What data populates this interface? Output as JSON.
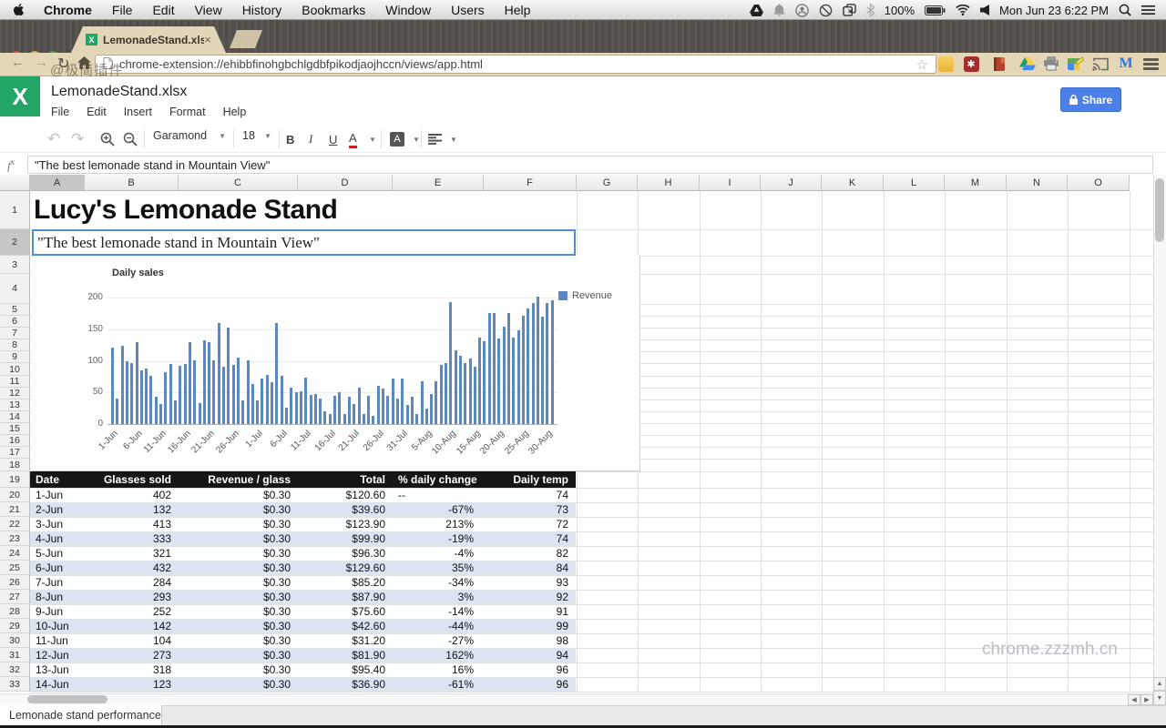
{
  "menu_bar": {
    "items": [
      "Chrome",
      "File",
      "Edit",
      "View",
      "History",
      "Bookmarks",
      "Window",
      "Users",
      "Help"
    ],
    "battery": "100%",
    "clock": "Mon Jun 23  6:22 PM"
  },
  "browser": {
    "tab_title": "LemonadeStand.xlsx",
    "url": "chrome-extension://ehibbfinohgbchlgdbfpikodjaojhccn/views/app.html"
  },
  "watermarks": {
    "address_bar": "@极简插件",
    "page": "chrome.zzzmh.cn"
  },
  "app": {
    "doc_title": "LemonadeStand.xlsx",
    "menus": [
      "File",
      "Edit",
      "Insert",
      "Format",
      "Help"
    ],
    "share_label": "Share",
    "toolbar": {
      "font_name": "Garamond",
      "font_size": "18"
    }
  },
  "formula_bar": {
    "label": "fx",
    "value": "\"The best lemonade stand in Mountain View\""
  },
  "sheet": {
    "column_letters": [
      "A",
      "B",
      "C",
      "D",
      "E",
      "F",
      "G",
      "H",
      "I",
      "J",
      "K",
      "L",
      "M",
      "N",
      "O"
    ],
    "selected_column": "A",
    "selected_row": 2,
    "cells": {
      "a1": "Lucy's Lemonade Stand",
      "a2": "\"The best lemonade stand in Mountain View\""
    },
    "sheet_tab": "Lemonade stand performance"
  },
  "chart_data": {
    "type": "bar",
    "title": "Daily sales",
    "legend": [
      "Revenue"
    ],
    "legend_position": "right",
    "color": "#5b87c3",
    "ylim": [
      0,
      200
    ],
    "yticks": [
      0,
      50,
      100,
      150,
      200
    ],
    "tick_every": 5,
    "x_tick_labels": [
      "1-Jun",
      "6-Jun",
      "11-Jun",
      "16-Jun",
      "21-Jun",
      "26-Jun",
      "1-Jul",
      "6-Jul",
      "11-Jul",
      "16-Jul",
      "21-Jul",
      "26-Jul",
      "31-Jul",
      "5-Aug",
      "10-Aug",
      "15-Aug",
      "20-Aug",
      "25-Aug",
      "30-Aug"
    ],
    "values": [
      120.6,
      39.6,
      123.9,
      99.9,
      96.3,
      129.6,
      85.2,
      87.9,
      75.6,
      42.6,
      31.2,
      81.9,
      95.4,
      36.9,
      92,
      95,
      130,
      100,
      33,
      132,
      129,
      101,
      159,
      91,
      152,
      94,
      105,
      37,
      101,
      63,
      38,
      72,
      78,
      66,
      159,
      76,
      26,
      57,
      50,
      52,
      74,
      46,
      47,
      41,
      20,
      16,
      45,
      51,
      16,
      43,
      31,
      58,
      16,
      45,
      13,
      60,
      56,
      44,
      72,
      41,
      72,
      30,
      43,
      16,
      68,
      24,
      47,
      67,
      94,
      96,
      193,
      116,
      108,
      97,
      103,
      90,
      136,
      131,
      175,
      175,
      135,
      154,
      176,
      137,
      148,
      171,
      183,
      192,
      201,
      170,
      192,
      195
    ]
  },
  "table": {
    "headers": [
      "Date",
      "Glasses sold",
      "Revenue / glass",
      "Total",
      "% daily change",
      "Daily temp"
    ],
    "rows": [
      [
        "1-Jun",
        "402",
        "$0.30",
        "$120.60",
        "--",
        "74"
      ],
      [
        "2-Jun",
        "132",
        "$0.30",
        "$39.60",
        "-67%",
        "73"
      ],
      [
        "3-Jun",
        "413",
        "$0.30",
        "$123.90",
        "213%",
        "72"
      ],
      [
        "4-Jun",
        "333",
        "$0.30",
        "$99.90",
        "-19%",
        "74"
      ],
      [
        "5-Jun",
        "321",
        "$0.30",
        "$96.30",
        "-4%",
        "82"
      ],
      [
        "6-Jun",
        "432",
        "$0.30",
        "$129.60",
        "35%",
        "84"
      ],
      [
        "7-Jun",
        "284",
        "$0.30",
        "$85.20",
        "-34%",
        "93"
      ],
      [
        "8-Jun",
        "293",
        "$0.30",
        "$87.90",
        "3%",
        "92"
      ],
      [
        "9-Jun",
        "252",
        "$0.30",
        "$75.60",
        "-14%",
        "91"
      ],
      [
        "10-Jun",
        "142",
        "$0.30",
        "$42.60",
        "-44%",
        "99"
      ],
      [
        "11-Jun",
        "104",
        "$0.30",
        "$31.20",
        "-27%",
        "98"
      ],
      [
        "12-Jun",
        "273",
        "$0.30",
        "$81.90",
        "162%",
        "94"
      ],
      [
        "13-Jun",
        "318",
        "$0.30",
        "$95.40",
        "16%",
        "96"
      ],
      [
        "14-Jun",
        "123",
        "$0.30",
        "$36.90",
        "-61%",
        "96"
      ]
    ]
  }
}
